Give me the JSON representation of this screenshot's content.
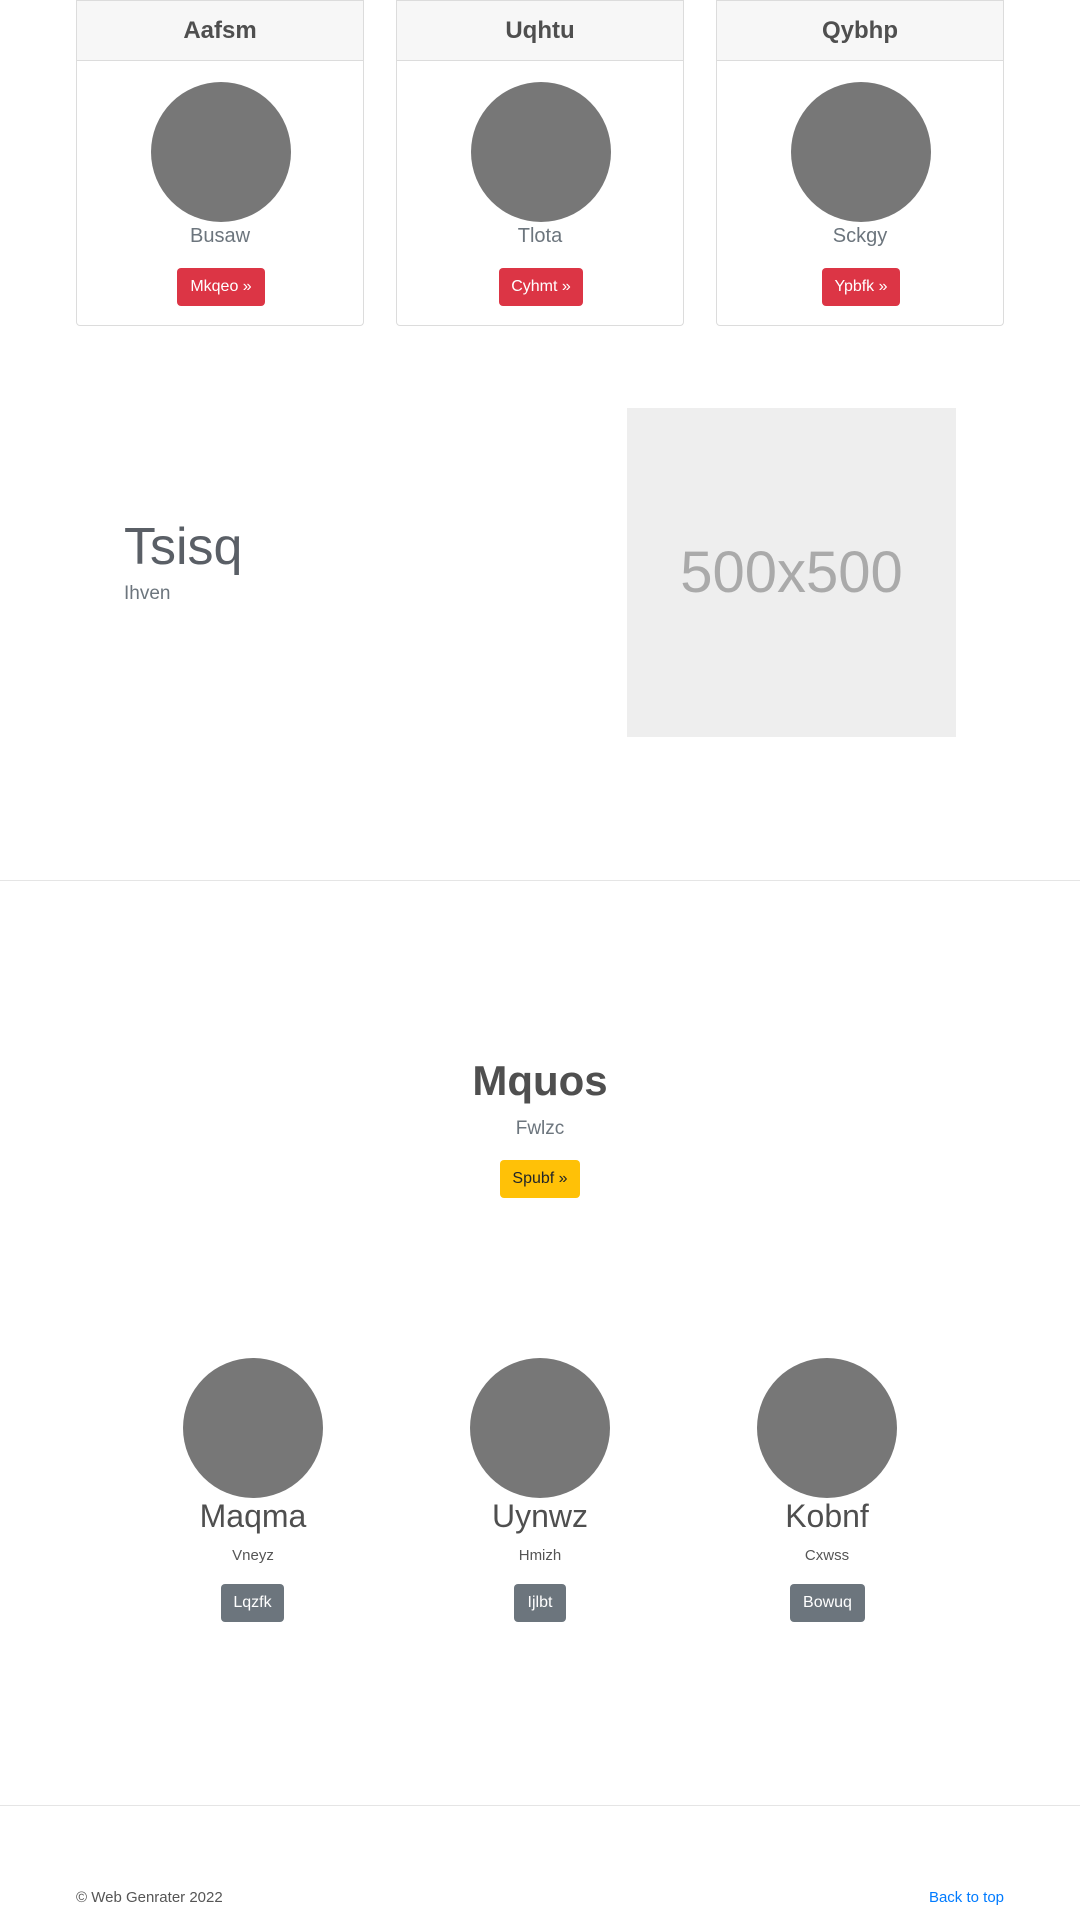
{
  "cards": [
    {
      "title": "Aafsm",
      "subtitle": "Busaw",
      "button": "Mkqeo »"
    },
    {
      "title": "Uqhtu",
      "subtitle": "Tlota",
      "button": "Cyhmt »"
    },
    {
      "title": "Qybhp",
      "subtitle": "Sckgy",
      "button": "Ypbfk »"
    }
  ],
  "feature": {
    "title": "Tsisq",
    "subtitle": "Ihven",
    "image_label": "500x500"
  },
  "jumbotron": {
    "title": "Mquos",
    "subtitle": "Fwlzc",
    "button": "Spubf »"
  },
  "columns": [
    {
      "title": "Maqma",
      "subtitle": "Vneyz",
      "button": "Lqzfk"
    },
    {
      "title": "Uynwz",
      "subtitle": "Hmizh",
      "button": "Ijlbt"
    },
    {
      "title": "Kobnf",
      "subtitle": "Cxwss",
      "button": "Bowuq"
    }
  ],
  "footer": {
    "copyright": "© Web Genrater 2022",
    "back_to_top": "Back to top"
  },
  "colors": {
    "danger": "#dc3545",
    "warning": "#ffc107",
    "secondary": "#6c757d",
    "link": "#007bff",
    "placeholder_bg": "#777777"
  }
}
